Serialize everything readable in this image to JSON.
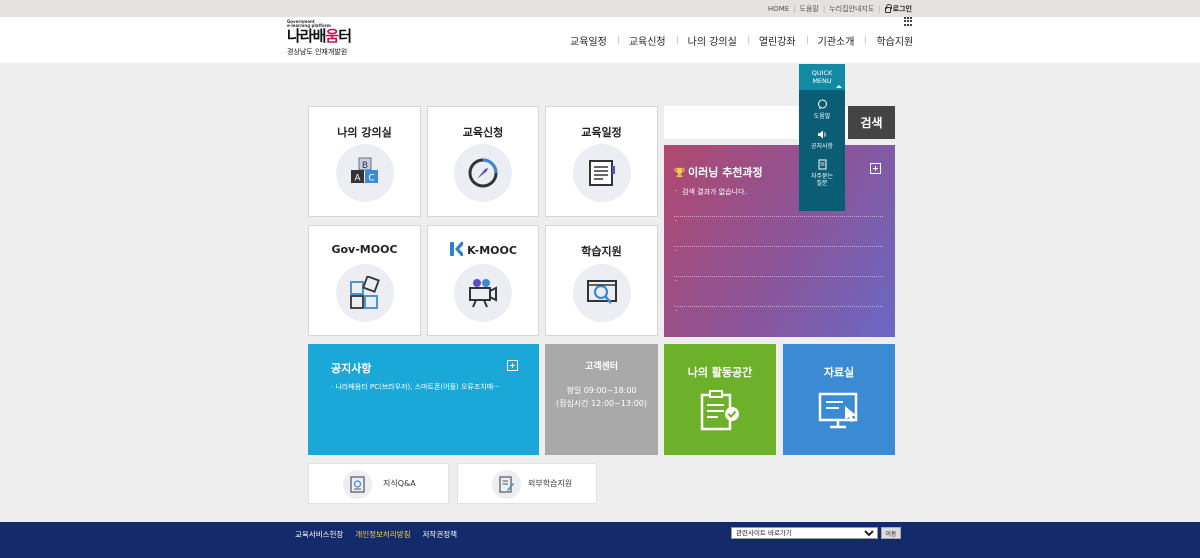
{
  "utility": {
    "home": "HOME",
    "help": "도움말",
    "sitemap": "누리집안내지도",
    "login": "로그인"
  },
  "header": {
    "logo_small_1": "Government",
    "logo_small_2": "e-learning platform",
    "logo_main_1": "나라배",
    "logo_main_2": "움",
    "logo_main_3": "터",
    "org_name": "경상남도 인재개발원",
    "nav": [
      "교육일정",
      "교육신청",
      "나의 강의실",
      "열린강좌",
      "기관소개",
      "학습지원"
    ]
  },
  "tiles": {
    "my_classroom": "나의 강의실",
    "apply": "교육신청",
    "schedule": "교육일정",
    "govmooc": "Gov-MOOC",
    "kmooc": "K-MOOC",
    "support": "학습지원"
  },
  "search": {
    "placeholder": "",
    "button": "검색"
  },
  "recommend": {
    "title": "이러닝 추천과정",
    "rows": [
      "검색 결과가 없습니다.",
      "",
      "",
      "",
      ""
    ]
  },
  "quick_menu": {
    "title_1": "QUICK",
    "title_2": "MENU",
    "help": "도움말",
    "notice": "공지사항",
    "faq_1": "자주묻는",
    "faq_2": "질문"
  },
  "notice": {
    "title": "공지사항",
    "items": [
      "나라배움터 PC(브라우저), 스마트폰(어플) 오류조치매···"
    ]
  },
  "customer_center": {
    "title": "고객센터",
    "hours": "평일 09:00~18:00",
    "lunch": "(점심시간 12:00~13:00)"
  },
  "my_space": {
    "title": "나의 활동공간"
  },
  "library": {
    "title": "자료실"
  },
  "bottom_links": {
    "qa": "지식Q&A",
    "external": "외부학습지원"
  },
  "footer": {
    "links": [
      "교육서비스헌장",
      "개인정보처리방침",
      "저작권정책"
    ],
    "related_select": "관련사이트 바로가기",
    "go_button": "이동"
  },
  "colors": {
    "notice_bg": "#1aa8d8",
    "customer_bg": "#a9a9a9",
    "myspace_bg": "#6db02a",
    "library_bg": "#3b8bd4",
    "footer_bg": "#132a6b",
    "quick_bg": "#0b5d75",
    "policy_highlight": "#f7d44a"
  }
}
